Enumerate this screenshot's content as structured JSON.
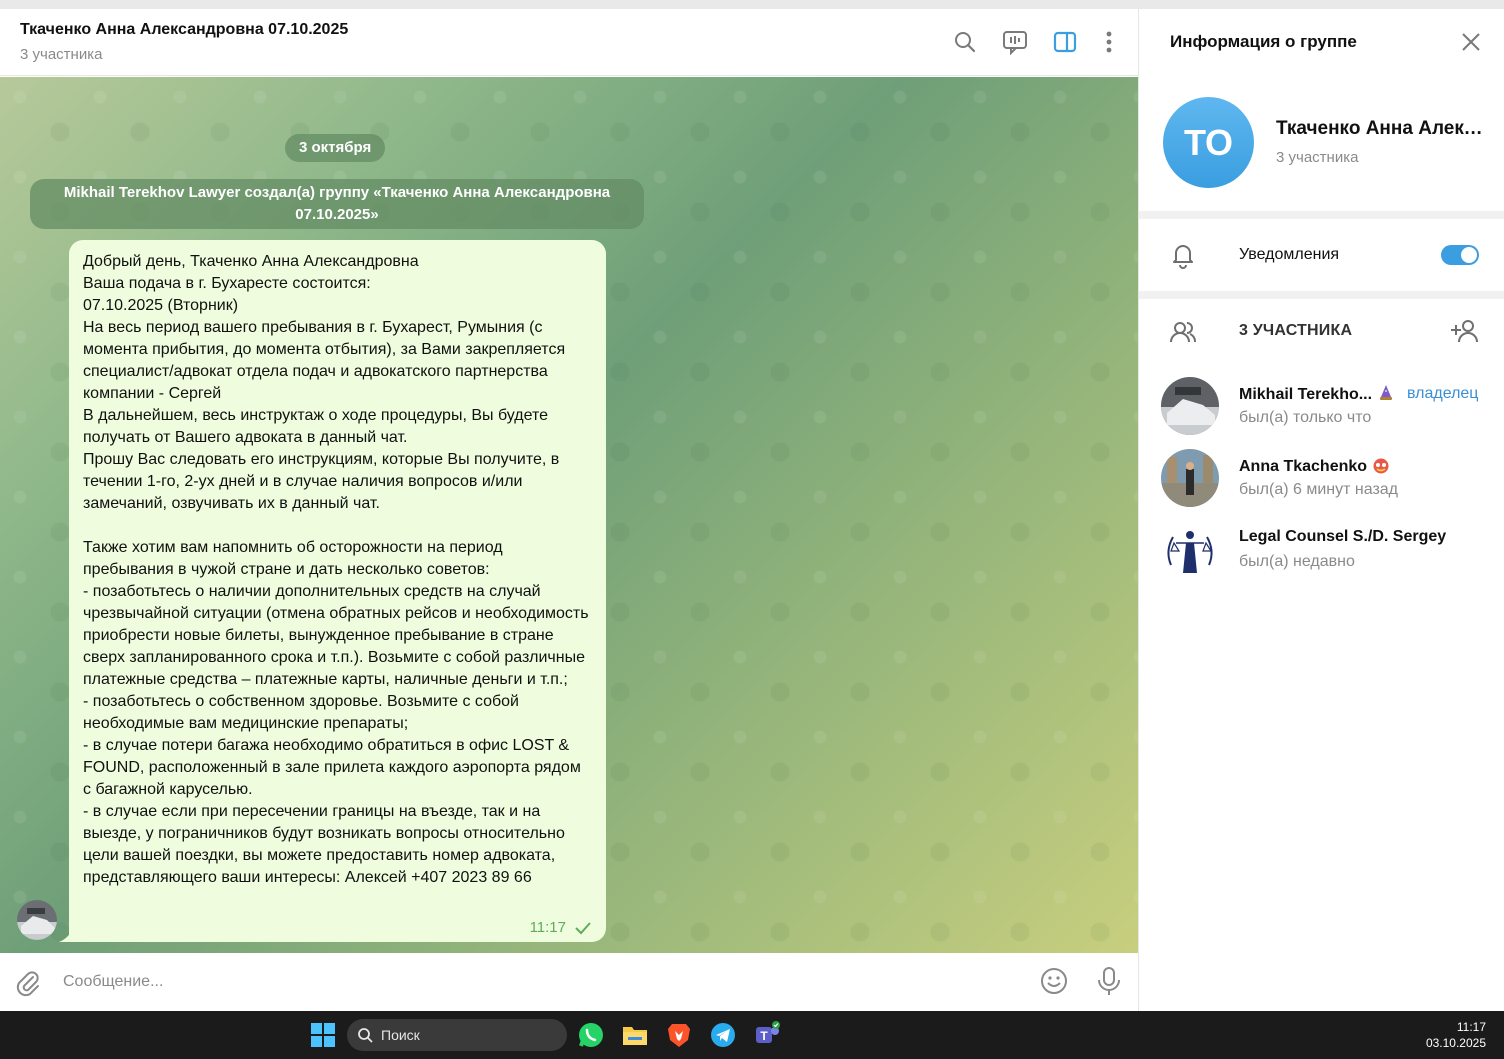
{
  "chat": {
    "title": "Ткаченко Анна Александровна 07.10.2025",
    "subtitle": "3 участника",
    "date_pill": "3 октября",
    "service_message": "Mikhail Terekhov Lawyer создал(а) группу «Ткаченко Анна Александровна 07.10.2025»",
    "message": {
      "text": "Добрый день, Ткаченко Анна Александровна\nВаша подача в г. Бухаресте состоится:\n07.10.2025 (Вторник)\nНа весь период вашего пребывания в г. Бухарест, Румыния (с момента прибытия, до момента отбытия), за Вами закрепляется специалист/адвокат отдела подач и адвокатского партнерства компании - Сергей\nВ дальнейшем, весь инструктаж о ходе процедуры, Вы будете получать от Вашего адвоката в данный чат.\nПрошу Вас следовать его инструкциям, которые Вы получите, в течении 1-го, 2-ух дней и в случае наличия вопросов и/или замечаний, озвучивать их в данный чат.\n\nТакже хотим вам напомнить об осторожности на период пребывания в чужой стране и дать несколько советов:\n- позаботьтесь о наличии дополнительных средств на случай чрезвычайной ситуации (отмена обратных рейсов и необходимость приобрести новые билеты, вынужденное пребывание в стране сверх запланированного срока и т.п.). Возьмите с собой различные платежные средства – платежные карты, наличные деньги и т.п.;\n- позаботьтесь о собственном здоровье. Возьмите с собой необходимые вам медицинские препараты;\n- в случае потери багажа необходимо обратиться в офис LOST & FOUND, расположенный в зале прилета каждого аэропорта рядом с багажной каруселью.\n- в случае если при пересечении границы на въезде, так и на выезде, у пограничников будут возникать вопросы относительно цели вашей поездки, вы можете предоставить номер адвоката, представляющего ваши интересы: Алексей +407 2023 89 66",
      "time": "11:17",
      "status_icon": "check-icon"
    },
    "composer_placeholder": "Сообщение...",
    "colors": {
      "accent": "#3a9ee0",
      "bubble": "#effdde",
      "time": "#5fac5c"
    }
  },
  "panel": {
    "title": "Информация о группе",
    "group_initials": "ТО",
    "group_name": "Ткаченко Анна Александровна 07.10.2025",
    "group_sub": "3 участника",
    "notifications_label": "Уведомления",
    "notifications_on": true,
    "members_header": "3 УЧАСТНИКА",
    "members": [
      {
        "name": "Mikhail Terekho...",
        "status": "был(а) только что",
        "role": "владелец"
      },
      {
        "name": "Anna Tkachenko",
        "status": "был(а) 6 минут назад",
        "role": ""
      },
      {
        "name": "Legal Counsel S./D. Sergey",
        "status": "был(а) недавно",
        "role": ""
      }
    ]
  },
  "taskbar": {
    "search_label": "Поиск",
    "time": "11:17",
    "date": "03.10.2025",
    "apps": [
      "whatsapp-icon",
      "file-explorer-icon",
      "brave-icon",
      "telegram-icon",
      "teams-icon"
    ]
  }
}
